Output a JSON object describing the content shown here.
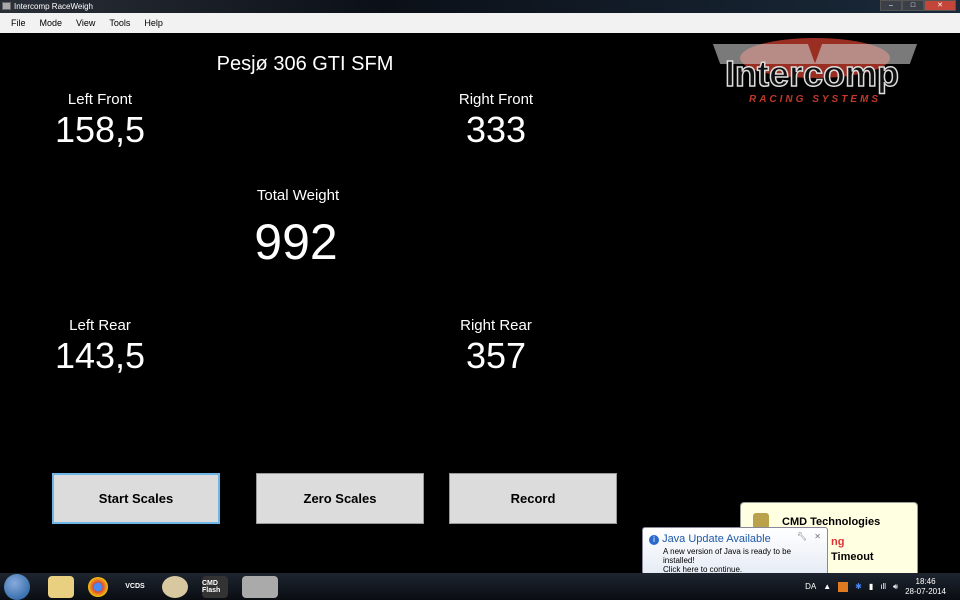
{
  "window": {
    "title": "Intercomp RaceWeigh",
    "minimize": "–",
    "maximize": "□",
    "close": "✕"
  },
  "menu": [
    "File",
    "Mode",
    "View",
    "Tools",
    "Help"
  ],
  "car_name": "Pesjø 306 GTI SFM",
  "logo": {
    "text": "Intercomp",
    "subtitle": "RACING SYSTEMS"
  },
  "weights": {
    "left_front": {
      "label": "Left Front",
      "value": "158,5"
    },
    "right_front": {
      "label": "Right Front",
      "value": "333"
    },
    "total": {
      "label": "Total Weight",
      "value": "992"
    },
    "left_rear": {
      "label": "Left Rear",
      "value": "143,5"
    },
    "right_rear": {
      "label": "Right Rear",
      "value": "357"
    }
  },
  "buttons": {
    "start": "Start Scales",
    "zero": "Zero Scales",
    "record": "Record"
  },
  "cmd_popup": {
    "title": "CMD Technologies",
    "line2": "ng",
    "line3": "Timeout"
  },
  "java_popup": {
    "title": "Java Update Available",
    "line1": "A new version of Java is ready to be installed!",
    "line2": "Click here to continue."
  },
  "taskbar": {
    "apps": [
      "explorer-icon",
      "chrome-icon",
      "vcds-icon",
      "paint-icon",
      "cmd-flash-icon",
      "raceweigh-icon"
    ],
    "cmd_flash_label": "CMD Flash",
    "vcds_label": "VCDS"
  },
  "tray": {
    "language": "DA",
    "time": "18:46",
    "date": "28-07-2014"
  }
}
